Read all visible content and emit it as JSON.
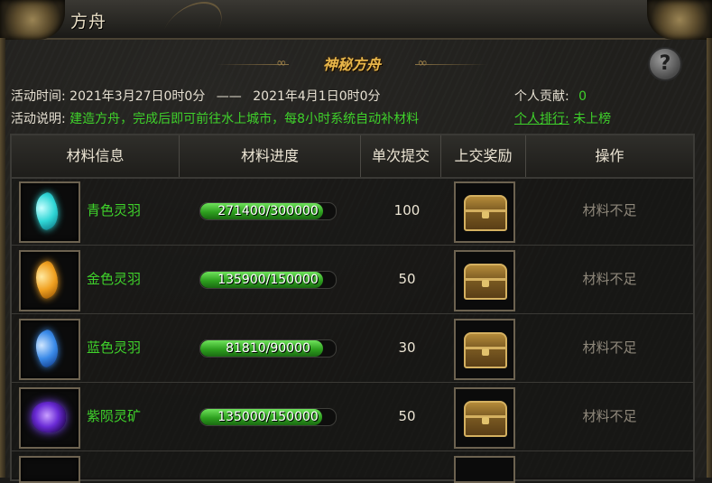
{
  "window": {
    "title": "方舟",
    "help_label": "?"
  },
  "panel": {
    "heading": "神秘方舟"
  },
  "activity": {
    "time_label": "活动时间:",
    "start": "2021年3月27日0时0分",
    "separator": "——",
    "end": "2021年4月1日0时0分",
    "desc_label": "活动说明:",
    "desc": "建造方舟，完成后即可前往水上城市，每8小时系统自动补材料",
    "contribution_label": "个人贡献:",
    "contribution_value": "0",
    "ranking_label": "个人排行:",
    "ranking_value": "未上榜"
  },
  "table": {
    "headers": [
      "材料信息",
      "材料进度",
      "单次提交",
      "上交奖励",
      "操作"
    ],
    "rows": [
      {
        "name": "青色灵羽",
        "icon": "cyan-feather-icon",
        "color": "#3fe0e0",
        "progress_text": "271400/300000",
        "current": 271400,
        "total": 300000,
        "per_submit": "100",
        "reward_icon": "treasure-chest-icon",
        "action": "材料不足"
      },
      {
        "name": "金色灵羽",
        "icon": "gold-feather-icon",
        "color": "#f0a020",
        "progress_text": "135900/150000",
        "current": 135900,
        "total": 150000,
        "per_submit": "50",
        "reward_icon": "treasure-chest-icon",
        "action": "材料不足"
      },
      {
        "name": "蓝色灵羽",
        "icon": "blue-feather-icon",
        "color": "#3a8ae8",
        "progress_text": "81810/90000",
        "current": 81810,
        "total": 90000,
        "per_submit": "30",
        "reward_icon": "treasure-chest-icon",
        "action": "材料不足"
      },
      {
        "name": "紫陨灵矿",
        "icon": "purple-ore-icon",
        "color": "#7d45ff",
        "progress_text": "135000/150000",
        "current": 135000,
        "total": 150000,
        "per_submit": "50",
        "reward_icon": "treasure-chest-icon",
        "action": "材料不足"
      }
    ]
  }
}
